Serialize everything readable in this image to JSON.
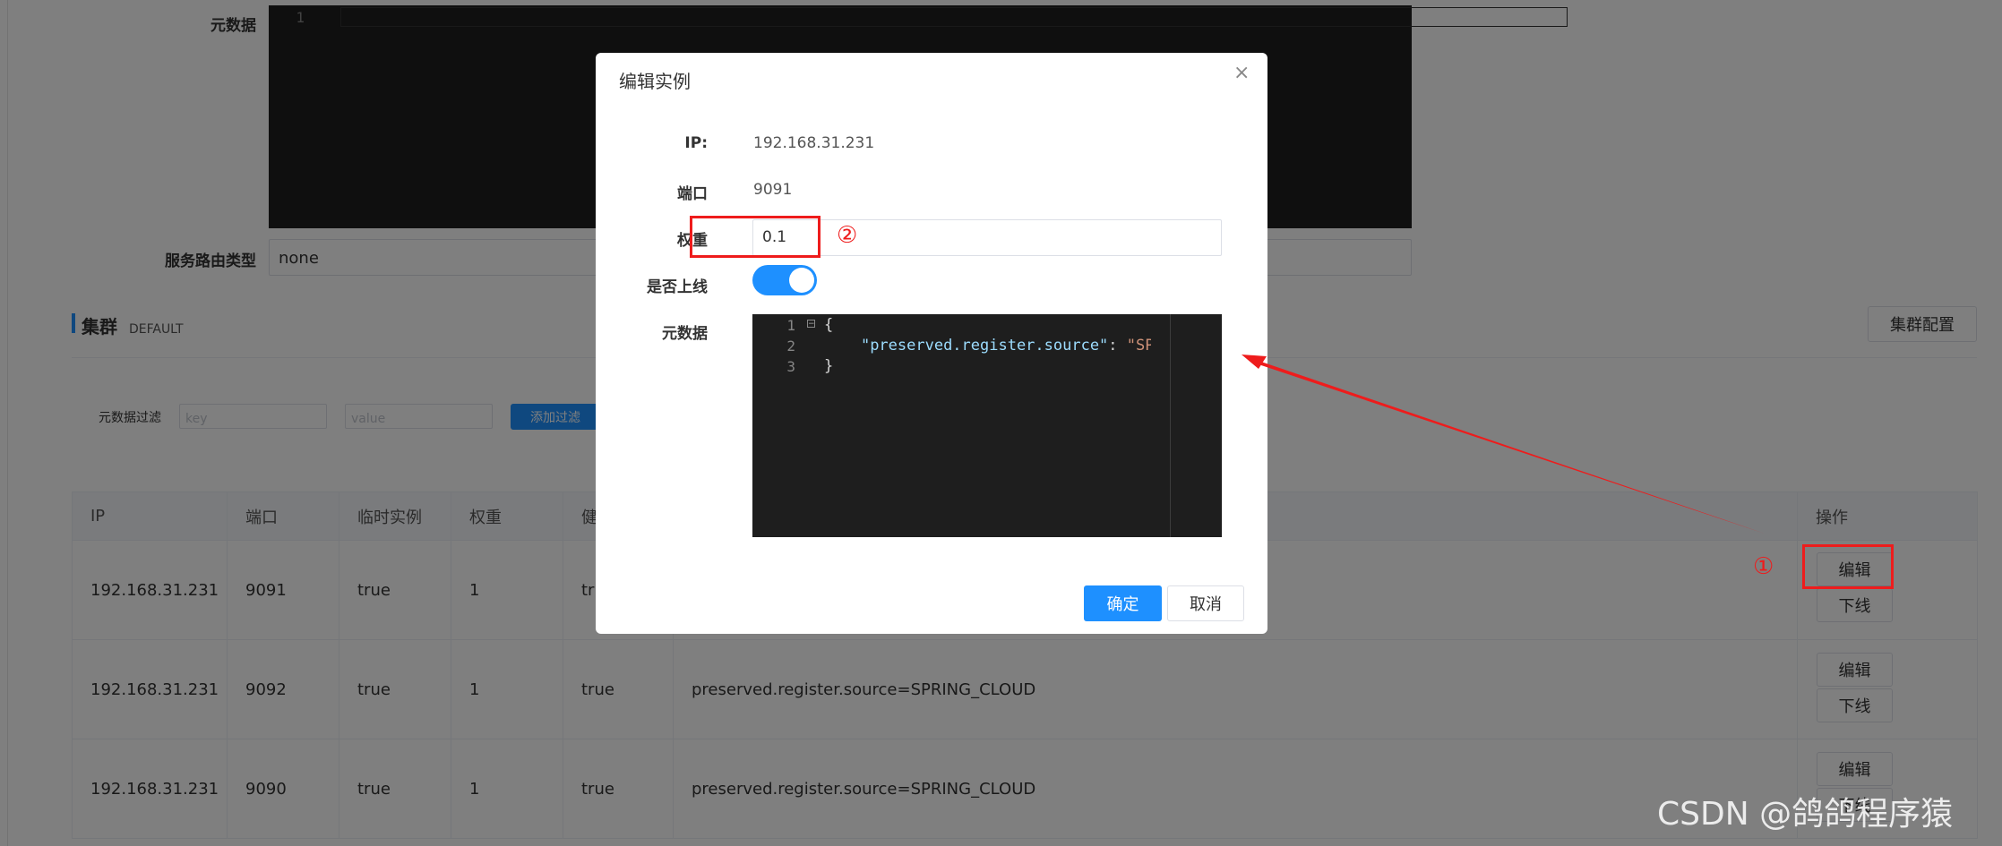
{
  "page": {
    "metadata_label": "元数据",
    "route_type_label": "服务路由类型",
    "route_type_value": "none",
    "line_one": "1",
    "cluster_title": "集群",
    "cluster_name": "DEFAULT",
    "cluster_config_btn": "集群配置",
    "filter_label": "元数据过滤",
    "filter_key_placeholder": "key",
    "filter_value_placeholder": "value",
    "add_filter_btn": "添加过滤"
  },
  "table": {
    "headers": [
      "IP",
      "端口",
      "临时实例",
      "权重",
      "健",
      "",
      "操作"
    ],
    "rows": [
      {
        "ip": "192.168.31.231",
        "port": "9091",
        "ephemeral": "true",
        "weight": "1",
        "healthy": "true",
        "metadata": "",
        "edit": "编辑",
        "offline": "下线"
      },
      {
        "ip": "192.168.31.231",
        "port": "9092",
        "ephemeral": "true",
        "weight": "1",
        "healthy": "true",
        "metadata": "preserved.register.source=SPRING_CLOUD",
        "edit": "编辑",
        "offline": "下线"
      },
      {
        "ip": "192.168.31.231",
        "port": "9090",
        "ephemeral": "true",
        "weight": "1",
        "healthy": "true",
        "metadata": "preserved.register.source=SPRING_CLOUD",
        "edit": "编辑",
        "offline": "下线"
      }
    ]
  },
  "modal": {
    "title": "编辑实例",
    "ip_label": "IP:",
    "ip_value": "192.168.31.231",
    "port_label": "端口",
    "port_value": "9091",
    "weight_label": "权重",
    "weight_value": "0.1",
    "online_label": "是否上线",
    "online_on": true,
    "metadata_label": "元数据",
    "code_lines": [
      "1",
      "2",
      "3"
    ],
    "code_l1": "{",
    "code_l2_key": "\"preserved.register.source\"",
    "code_l2_colon": ": ",
    "code_l2_val": "\"SPRING",
    "code_l3": "}",
    "confirm_btn": "确定",
    "cancel_btn": "取消"
  },
  "annotations": {
    "step1": "①",
    "step2": "②",
    "color": "#ee1c1c"
  },
  "watermark": "CSDN @鸽鸽程序猿",
  "colors": {
    "primary": "#1e90ff",
    "accent_bar": "#1e90ff",
    "editor_bg": "#1e1e1e"
  }
}
